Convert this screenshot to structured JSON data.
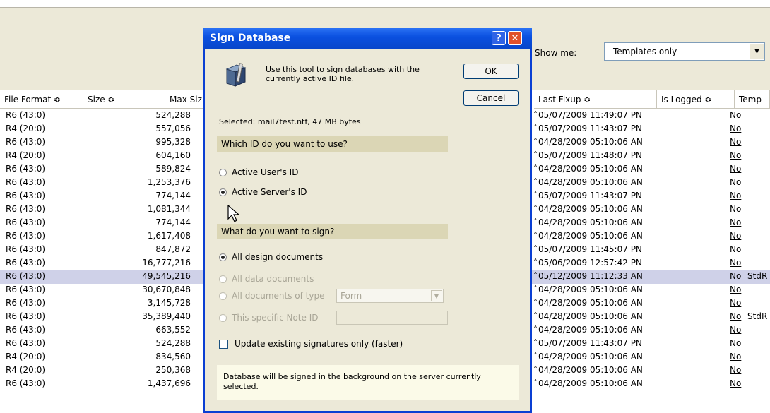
{
  "filter": {
    "show_me_label": "Show me:",
    "show_me_value": "Templates only"
  },
  "columns": {
    "file_format": "File Format ≎",
    "size": "Size ≎",
    "max_size": "Max Siz",
    "last_fixup": "Last Fixup ≎",
    "is_logged": "Is Logged ≎",
    "template": "Temp"
  },
  "rows": [
    {
      "format": "R6 (43:0)",
      "size": "524,288",
      "fixup": "05/07/2009 11:49:07 PN",
      "logged": "No",
      "template": ""
    },
    {
      "format": "R4 (20:0)",
      "size": "557,056",
      "fixup": "05/07/2009 11:43:07 PN",
      "logged": "No",
      "template": ""
    },
    {
      "format": "R6 (43:0)",
      "size": "995,328",
      "fixup": "04/28/2009 05:10:06 AN",
      "logged": "No",
      "template": ""
    },
    {
      "format": "R4 (20:0)",
      "size": "604,160",
      "fixup": "05/07/2009 11:48:07 PN",
      "logged": "No",
      "template": ""
    },
    {
      "format": "R6 (43:0)",
      "size": "589,824",
      "fixup": "04/28/2009 05:10:06 AN",
      "logged": "No",
      "template": ""
    },
    {
      "format": "R6 (43:0)",
      "size": "1,253,376",
      "fixup": "04/28/2009 05:10:06 AN",
      "logged": "No",
      "template": ""
    },
    {
      "format": "R6 (43:0)",
      "size": "774,144",
      "fixup": "05/07/2009 11:43:07 PN",
      "logged": "No",
      "template": ""
    },
    {
      "format": "R6 (43:0)",
      "size": "1,081,344",
      "fixup": "04/28/2009 05:10:06 AN",
      "logged": "No",
      "template": ""
    },
    {
      "format": "R6 (43:0)",
      "size": "774,144",
      "fixup": "04/28/2009 05:10:06 AN",
      "logged": "No",
      "template": ""
    },
    {
      "format": "R6 (43:0)",
      "size": "1,617,408",
      "fixup": "04/28/2009 05:10:06 AN",
      "logged": "No",
      "template": ""
    },
    {
      "format": "R6 (43:0)",
      "size": "847,872",
      "fixup": "05/07/2009 11:45:07 PN",
      "logged": "No",
      "template": ""
    },
    {
      "format": "R6 (43:0)",
      "size": "16,777,216",
      "fixup": "05/06/2009 12:57:42 PN",
      "logged": "No",
      "template": ""
    },
    {
      "format": "R6 (43:0)",
      "size": "49,545,216",
      "fixup": "05/12/2009 11:12:33 AN",
      "logged": "No",
      "template": "StdR"
    },
    {
      "format": "R6 (43:0)",
      "size": "30,670,848",
      "fixup": "04/28/2009 05:10:06 AN",
      "logged": "No",
      "template": ""
    },
    {
      "format": "R6 (43:0)",
      "size": "3,145,728",
      "fixup": "04/28/2009 05:10:06 AN",
      "logged": "No",
      "template": ""
    },
    {
      "format": "R6 (43:0)",
      "size": "35,389,440",
      "fixup": "04/28/2009 05:10:06 AN",
      "logged": "No",
      "template": "StdR"
    },
    {
      "format": "R6 (43:0)",
      "size": "663,552",
      "fixup": "04/28/2009 05:10:06 AN",
      "logged": "No",
      "template": ""
    },
    {
      "format": "R6 (43:0)",
      "size": "524,288",
      "fixup": "05/07/2009 11:43:07 PN",
      "logged": "No",
      "template": ""
    },
    {
      "format": "R4 (20:0)",
      "size": "834,560",
      "fixup": "04/28/2009 05:10:06 AN",
      "logged": "No",
      "template": ""
    },
    {
      "format": "R4 (20:0)",
      "size": "250,368",
      "fixup": "04/28/2009 05:10:06 AN",
      "logged": "No",
      "template": ""
    },
    {
      "format": "R6 (43:0)",
      "size": "1,437,696",
      "fixup": "04/28/2009 05:10:06 AN",
      "logged": "No",
      "template": ""
    }
  ],
  "selected_row_index": 12,
  "dialog": {
    "title": "Sign Database",
    "help_glyph": "?",
    "close_glyph": "✕",
    "intro": "Use this tool to sign databases with the currently active ID file.",
    "ok_label": "OK",
    "cancel_label": "Cancel",
    "selected_text": "Selected:  mail7test.ntf, 47 MB bytes",
    "id_section_label": "Which ID do you want to use?",
    "id_options": [
      {
        "label": "Active User's ID",
        "checked": false
      },
      {
        "label": "Active Server's ID",
        "checked": true
      }
    ],
    "sign_section_label": "What do you want to sign?",
    "sign_options": [
      {
        "label": "All design documents",
        "checked": true,
        "enabled": true
      },
      {
        "label": "All data documents",
        "checked": false,
        "enabled": false
      },
      {
        "label": "All documents of type",
        "checked": false,
        "enabled": false
      },
      {
        "label": "This specific Note ID",
        "checked": false,
        "enabled": false
      }
    ],
    "type_value": "Form",
    "update_checkbox_label": "Update existing signatures only (faster)",
    "info_text": "Database will be signed in the background on the server currently selected."
  },
  "colors": {
    "title_bar": "#0a50e0",
    "selected_row": "#cfd1e8",
    "section_band": "#dbd6b5",
    "dialog_bg": "#ece9d8"
  }
}
